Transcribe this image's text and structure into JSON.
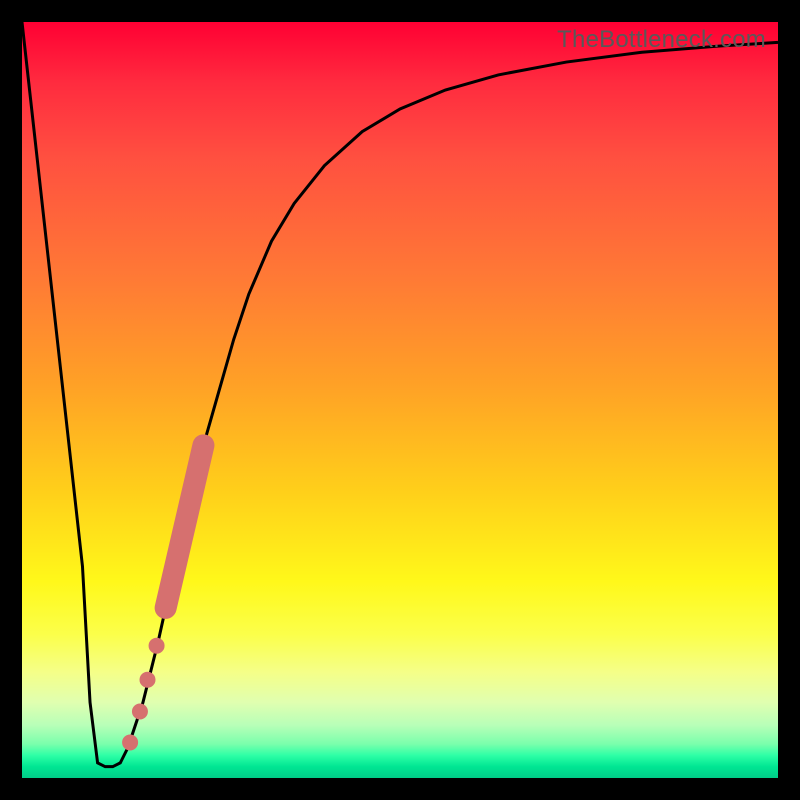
{
  "watermark": "TheBottleneck.com",
  "colors": {
    "background": "#000000",
    "curve": "#000000",
    "marker_fill": "#d6706f",
    "marker_stroke": "#c45a59"
  },
  "chart_data": {
    "type": "line",
    "title": "",
    "xlabel": "",
    "ylabel": "",
    "xlim": [
      0,
      100
    ],
    "ylim": [
      0,
      100
    ],
    "grid": false,
    "series": [
      {
        "name": "bottleneck-curve",
        "x": [
          0,
          2,
          4,
          6,
          8,
          9,
          10,
          11,
          12,
          13,
          14,
          16,
          18,
          20,
          22,
          24,
          26,
          28,
          30,
          33,
          36,
          40,
          45,
          50,
          56,
          63,
          72,
          82,
          92,
          100
        ],
        "y": [
          100,
          82,
          64,
          46,
          28,
          10,
          2,
          1.5,
          1.5,
          2,
          4,
          10,
          18,
          27,
          36,
          44,
          51,
          58,
          64,
          71,
          76,
          81,
          85.5,
          88.5,
          91,
          93,
          94.7,
          96,
          96.8,
          97.3
        ]
      }
    ],
    "markers_cluster": {
      "name": "highlighted-points",
      "big_segment": {
        "x_start": 19.0,
        "y_start": 22.5,
        "x_end": 24.0,
        "y_end": 44.0,
        "radius": 11
      },
      "points": [
        {
          "x": 17.8,
          "y": 17.5,
          "r": 8
        },
        {
          "x": 16.6,
          "y": 13.0,
          "r": 8
        },
        {
          "x": 15.6,
          "y": 8.8,
          "r": 8
        },
        {
          "x": 14.3,
          "y": 4.7,
          "r": 8
        }
      ]
    }
  }
}
